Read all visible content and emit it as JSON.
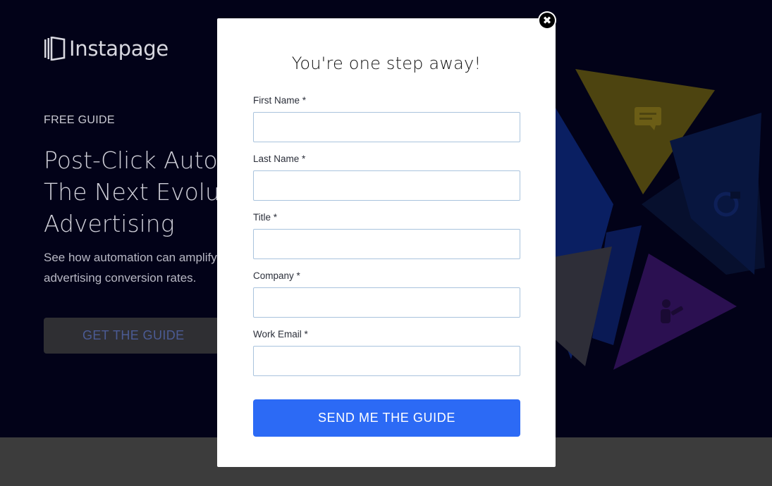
{
  "page": {
    "logo_text": "Instapage",
    "eyebrow": "FREE GUIDE",
    "headline_lines": [
      "Post-Click Autom",
      "The Next Evolut",
      "Advertising"
    ],
    "subtext_lines": [
      "See how automation can amplify",
      "advertising conversion rates."
    ],
    "cta_label": "GET THE GUIDE"
  },
  "modal": {
    "title": "You're one step away!",
    "fields": [
      {
        "label": "First Name *",
        "value": ""
      },
      {
        "label": "Last Name *",
        "value": ""
      },
      {
        "label": "Title *",
        "value": ""
      },
      {
        "label": "Company *",
        "value": ""
      },
      {
        "label": "Work Email *",
        "value": ""
      }
    ],
    "submit_label": "SEND ME THE GUIDE",
    "close_glyph": "✖"
  },
  "colors": {
    "hero_background": "#020218",
    "submit_button": "#2c6af5",
    "input_border": "#a9c3dd",
    "footer_band": "#3c3c3c"
  },
  "icons": [
    "instapage-logo-icon",
    "close-icon",
    "chat-icon",
    "refresh-icon",
    "person-icon"
  ]
}
